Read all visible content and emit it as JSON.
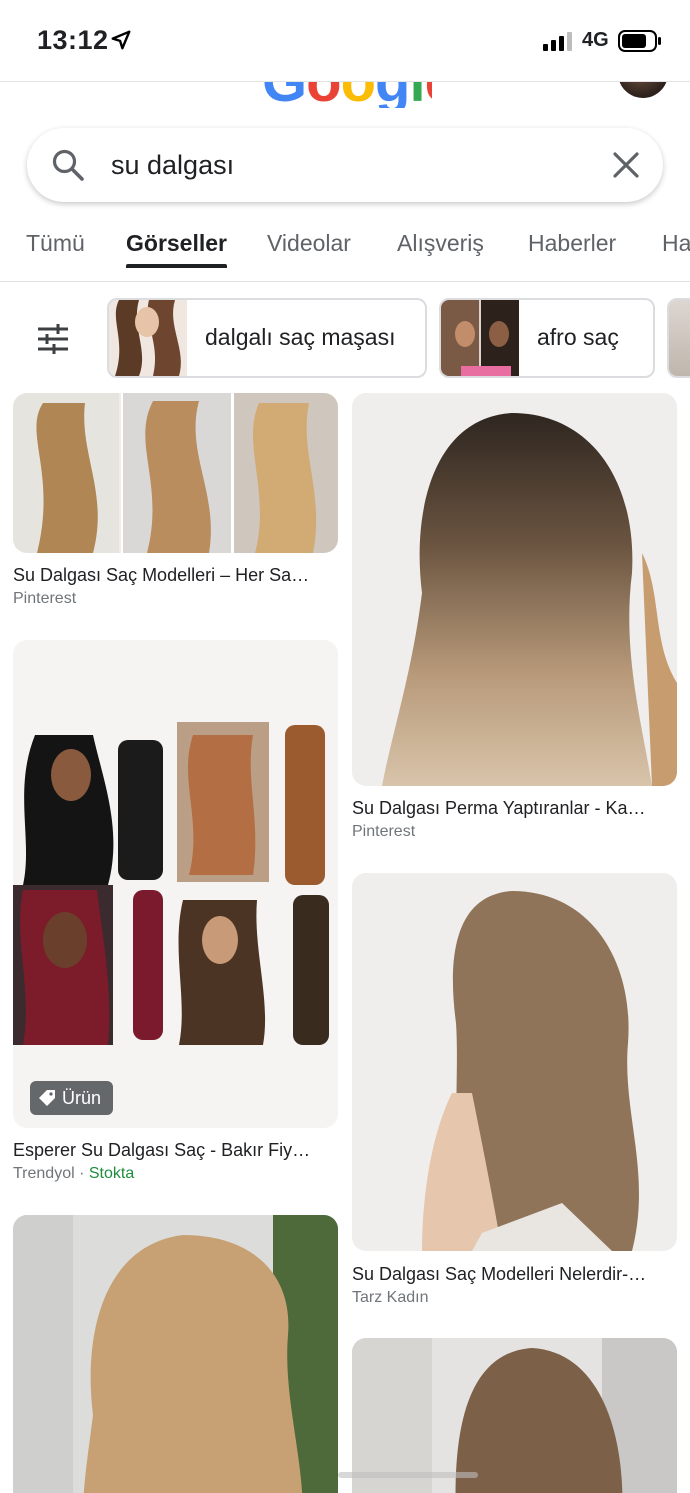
{
  "status_bar": {
    "time": "13:12",
    "network": "4G"
  },
  "logo": {
    "text": "Google",
    "colors": [
      "#4285F4",
      "#EA4335",
      "#FBBC05",
      "#4285F4",
      "#34A853",
      "#EA4335"
    ]
  },
  "search": {
    "query": "su dalgası",
    "placeholder": ""
  },
  "tabs": [
    {
      "label": "Tümü",
      "active": false
    },
    {
      "label": "Görseller",
      "active": true
    },
    {
      "label": "Videolar",
      "active": false
    },
    {
      "label": "Alışveriş",
      "active": false
    },
    {
      "label": "Haberler",
      "active": false
    },
    {
      "label": "Ha",
      "active": false
    }
  ],
  "chips": [
    {
      "label": "dalgalı saç maşası"
    },
    {
      "label": "afro saç"
    }
  ],
  "results": [
    {
      "title": "Su Dalgası Saç Modelleri – Her Sa…",
      "source": "Pinterest"
    },
    {
      "title": "Su Dalgası Perma Yaptıranlar - Ka…",
      "source": "Pinterest"
    },
    {
      "title": "Esperer Su Dalgası Saç - Bakır Fiy…",
      "source": "Trendyol",
      "stock": "Stokta",
      "badge": "Ürün"
    },
    {
      "title": "Su Dalgası Saç Modelleri Nelerdir-…",
      "source": "Tarz Kadın"
    }
  ],
  "colors": {
    "accent": "#202124",
    "stock_green": "#1e8e3e",
    "secondary_text": "#70757a"
  },
  "icons": [
    "location-arrow-icon",
    "signal-icon",
    "battery-icon",
    "search-icon",
    "close-icon",
    "filter-icon",
    "tag-icon"
  ]
}
